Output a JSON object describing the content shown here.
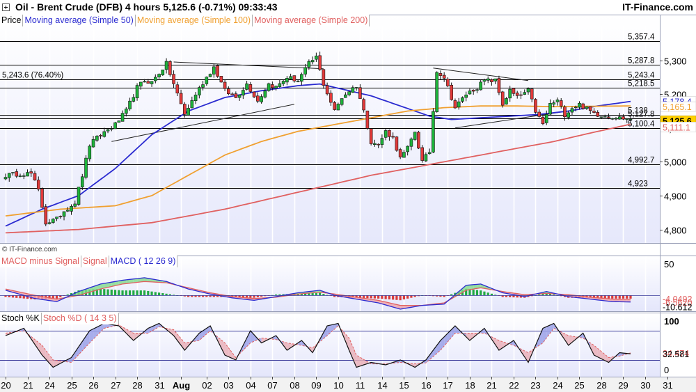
{
  "header": {
    "title": "Oil - Brent Crude (DFB)   4 hours   5,125.6 (-0.71%)   09:33:43",
    "brand": "IT-Finance.com"
  },
  "legends": {
    "price": [
      {
        "label": "Price",
        "color": "#000000"
      },
      {
        "label": "Moving average (Simple 50)",
        "color": "#2b2bd0"
      },
      {
        "label": "Moving average (Simple 100)",
        "color": "#f0a030"
      },
      {
        "label": "Moving average (Simple 200)",
        "color": "#e06060"
      }
    ],
    "macd": [
      {
        "label": "MACD minus Signal",
        "color": "#e06060"
      },
      {
        "label": "Signal",
        "color": "#e06060"
      },
      {
        "label": "MACD ( 12 26 9)",
        "color": "#2b2bd0"
      }
    ],
    "stoch": [
      {
        "label": "Stoch %K",
        "color": "#000000"
      },
      {
        "label": "Stoch %D ( 14 3 5)",
        "color": "#e06060"
      }
    ]
  },
  "watermark": "© IT-Finance.com",
  "chart_data": {
    "type": "candlestick",
    "price_axis": {
      "ylim": [
        4760,
        5400
      ],
      "ticks": [
        {
          "v": 4800,
          "label": "4,800"
        },
        {
          "v": 4900,
          "label": "4,900"
        },
        {
          "v": 5000,
          "label": "5,000"
        },
        {
          "v": 5100,
          "label": "5,100"
        },
        {
          "v": 5200,
          "label": "5,200"
        },
        {
          "v": 5300,
          "label": "5,300"
        }
      ]
    },
    "x_axis": {
      "labels": [
        "20",
        "21",
        "24",
        "25",
        "26",
        "27",
        "28",
        "31",
        "Aug",
        "02",
        "03",
        "04",
        "07",
        "08",
        "09",
        "10",
        "11",
        "14",
        "15",
        "16",
        "17",
        "18",
        "21",
        "22",
        "23",
        "24",
        "25",
        "28",
        "29",
        "30",
        "31"
      ],
      "label_index": [
        0,
        6,
        12,
        18,
        24,
        30,
        36,
        42,
        48,
        55,
        61,
        67,
        73,
        79,
        85,
        91,
        97,
        103,
        109,
        115,
        121,
        127,
        133,
        139,
        145,
        151,
        157,
        163,
        169,
        175,
        181
      ],
      "total_bars": 172
    },
    "horizontal_levels": [
      {
        "value": 5357.4,
        "label": "5,357.4",
        "side": "right"
      },
      {
        "value": 5287.8,
        "label": "5,287.8",
        "side": "right"
      },
      {
        "value": 5243.6,
        "label": "5,243.6 (76.40%)",
        "side": "left"
      },
      {
        "value": 5243.4,
        "label": "5,243.4",
        "side": "right"
      },
      {
        "value": 5218.5,
        "label": "5,218.5",
        "side": "right"
      },
      {
        "value": 5138,
        "label": "5,138",
        "side": "right"
      },
      {
        "value": 5127.8,
        "label": "5,127.8",
        "side": "right"
      },
      {
        "value": 5100.4,
        "label": "5,100.4",
        "side": "right"
      },
      {
        "value": 4992.7,
        "label": "4,992.7",
        "side": "right"
      },
      {
        "value": 4923,
        "label": "4,923",
        "side": "right"
      }
    ],
    "price_tags": [
      {
        "value": 5178.4,
        "label": "5,178.4",
        "color": "#2b2bd0",
        "bg": "#ffffff"
      },
      {
        "value": 5165.1,
        "label": "5,165.1",
        "color": "#f0a030",
        "bg": "#ffffff"
      },
      {
        "value": 5125.6,
        "label": "5,125.6",
        "color": "#000000",
        "bg": "#ffd000"
      },
      {
        "value": 5111.1,
        "label": "5,111.1",
        "color": "#e06060",
        "bg": "#ffffff"
      }
    ],
    "trendlines": [
      {
        "points": [
          [
            29,
            5060
          ],
          [
            79,
            5170
          ]
        ]
      },
      {
        "points": [
          [
            46,
            5295
          ],
          [
            87,
            5275
          ]
        ]
      },
      {
        "points": [
          [
            117,
            5277
          ],
          [
            143,
            5240
          ]
        ]
      },
      {
        "points": [
          [
            123,
            5100
          ],
          [
            160,
            5160
          ]
        ]
      }
    ],
    "close_keypoints": [
      [
        0,
        4960
      ],
      [
        4,
        4965
      ],
      [
        7,
        4965
      ],
      [
        9,
        4915
      ],
      [
        11,
        4820
      ],
      [
        14,
        4830
      ],
      [
        16,
        4855
      ],
      [
        19,
        4880
      ],
      [
        21,
        4960
      ],
      [
        23,
        5050
      ],
      [
        26,
        5080
      ],
      [
        30,
        5110
      ],
      [
        33,
        5150
      ],
      [
        36,
        5220
      ],
      [
        38,
        5240
      ],
      [
        40,
        5235
      ],
      [
        44,
        5290
      ],
      [
        47,
        5200
      ],
      [
        49,
        5140
      ],
      [
        52,
        5200
      ],
      [
        55,
        5250
      ],
      [
        57,
        5280
      ],
      [
        60,
        5210
      ],
      [
        63,
        5190
      ],
      [
        66,
        5230
      ],
      [
        69,
        5180
      ],
      [
        72,
        5230
      ],
      [
        74,
        5220
      ],
      [
        77,
        5250
      ],
      [
        80,
        5240
      ],
      [
        83,
        5290
      ],
      [
        85,
        5310
      ],
      [
        87,
        5230
      ],
      [
        90,
        5150
      ],
      [
        92,
        5190
      ],
      [
        94,
        5210
      ],
      [
        96,
        5225
      ],
      [
        98,
        5150
      ],
      [
        100,
        5060
      ],
      [
        102,
        5050
      ],
      [
        104,
        5090
      ],
      [
        106,
        5070
      ],
      [
        108,
        5010
      ],
      [
        110,
        5040
      ],
      [
        112,
        5090
      ],
      [
        114,
        5000
      ],
      [
        116,
        5030
      ],
      [
        118,
        5270
      ],
      [
        120,
        5250
      ],
      [
        123,
        5160
      ],
      [
        126,
        5200
      ],
      [
        129,
        5220
      ],
      [
        131,
        5240
      ],
      [
        134,
        5240
      ],
      [
        136,
        5170
      ],
      [
        138,
        5210
      ],
      [
        140,
        5190
      ],
      [
        143,
        5210
      ],
      [
        145,
        5150
      ],
      [
        147,
        5110
      ],
      [
        149,
        5170
      ],
      [
        151,
        5180
      ],
      [
        153,
        5140
      ],
      [
        155,
        5160
      ],
      [
        157,
        5170
      ],
      [
        160,
        5150
      ],
      [
        162,
        5140
      ],
      [
        165,
        5135
      ],
      [
        168,
        5130
      ],
      [
        171,
        5125.6
      ]
    ],
    "series": [
      {
        "name": "Moving average (Simple 50)",
        "color": "#2b2bd0",
        "points": [
          [
            0,
            4810
          ],
          [
            10,
            4860
          ],
          [
            20,
            4900
          ],
          [
            30,
            4980
          ],
          [
            40,
            5080
          ],
          [
            50,
            5150
          ],
          [
            60,
            5190
          ],
          [
            70,
            5210
          ],
          [
            80,
            5225
          ],
          [
            86,
            5230
          ],
          [
            92,
            5215
          ],
          [
            100,
            5195
          ],
          [
            108,
            5165
          ],
          [
            116,
            5135
          ],
          [
            122,
            5125
          ],
          [
            130,
            5130
          ],
          [
            138,
            5135
          ],
          [
            146,
            5140
          ],
          [
            154,
            5150
          ],
          [
            162,
            5165
          ],
          [
            171,
            5178.4
          ]
        ]
      },
      {
        "name": "Moving average (Simple 100)",
        "color": "#f0a030",
        "points": [
          [
            0,
            4840
          ],
          [
            15,
            4860
          ],
          [
            30,
            4870
          ],
          [
            40,
            4900
          ],
          [
            50,
            4960
          ],
          [
            60,
            5020
          ],
          [
            70,
            5060
          ],
          [
            80,
            5090
          ],
          [
            90,
            5110
          ],
          [
            100,
            5130
          ],
          [
            110,
            5150
          ],
          [
            120,
            5160
          ],
          [
            130,
            5165
          ],
          [
            140,
            5165
          ],
          [
            150,
            5163
          ],
          [
            160,
            5164
          ],
          [
            171,
            5165.1
          ]
        ]
      },
      {
        "name": "Moving average (Simple 200)",
        "color": "#e06060",
        "points": [
          [
            0,
            4790
          ],
          [
            20,
            4800
          ],
          [
            40,
            4820
          ],
          [
            60,
            4860
          ],
          [
            80,
            4910
          ],
          [
            100,
            4960
          ],
          [
            110,
            4980
          ],
          [
            120,
            5000
          ],
          [
            130,
            5020
          ],
          [
            140,
            5040
          ],
          [
            150,
            5060
          ],
          [
            160,
            5085
          ],
          [
            171,
            5111.1
          ]
        ]
      }
    ],
    "macd": {
      "ylim": [
        -22,
        60
      ],
      "ticks": [
        {
          "v": 50,
          "label": "50"
        }
      ],
      "tags": [
        {
          "value": -4.049,
          "label": "-4.0492",
          "color": "#e06060"
        },
        {
          "value": -6.562,
          "label": "-6.5620",
          "color": "#e06060"
        },
        {
          "value": -10.612,
          "label": "-10.612",
          "color": "#000000"
        }
      ],
      "macd_keypoints": [
        [
          0,
          8
        ],
        [
          8,
          -5
        ],
        [
          14,
          -10
        ],
        [
          20,
          6
        ],
        [
          26,
          18
        ],
        [
          32,
          24
        ],
        [
          38,
          28
        ],
        [
          44,
          22
        ],
        [
          50,
          10
        ],
        [
          56,
          2
        ],
        [
          62,
          -4
        ],
        [
          68,
          -8
        ],
        [
          74,
          -2
        ],
        [
          80,
          4
        ],
        [
          86,
          8
        ],
        [
          90,
          0
        ],
        [
          96,
          -6
        ],
        [
          102,
          -12
        ],
        [
          108,
          -22
        ],
        [
          114,
          -16
        ],
        [
          120,
          -14
        ],
        [
          126,
          16
        ],
        [
          130,
          18
        ],
        [
          136,
          4
        ],
        [
          142,
          -2
        ],
        [
          148,
          6
        ],
        [
          154,
          -2
        ],
        [
          160,
          -6
        ],
        [
          166,
          -10
        ],
        [
          171,
          -10.6
        ]
      ],
      "signal_keypoints": [
        [
          0,
          10
        ],
        [
          8,
          0
        ],
        [
          14,
          -6
        ],
        [
          20,
          0
        ],
        [
          26,
          10
        ],
        [
          32,
          18
        ],
        [
          38,
          22
        ],
        [
          44,
          20
        ],
        [
          50,
          12
        ],
        [
          56,
          4
        ],
        [
          62,
          -2
        ],
        [
          68,
          -5
        ],
        [
          74,
          -3
        ],
        [
          80,
          2
        ],
        [
          86,
          5
        ],
        [
          90,
          2
        ],
        [
          96,
          -3
        ],
        [
          102,
          -8
        ],
        [
          108,
          -16
        ],
        [
          114,
          -16
        ],
        [
          120,
          -12
        ],
        [
          126,
          8
        ],
        [
          130,
          12
        ],
        [
          136,
          6
        ],
        [
          142,
          1
        ],
        [
          148,
          3
        ],
        [
          154,
          1
        ],
        [
          160,
          -3
        ],
        [
          166,
          -6
        ],
        [
          171,
          -6.56
        ]
      ]
    },
    "stoch": {
      "ylim": [
        0,
        100
      ],
      "ticks": [
        {
          "v": 0,
          "label": "0"
        },
        {
          "v": 100,
          "label": "100"
        }
      ],
      "overbought": 80,
      "oversold": 20,
      "tags": [
        {
          "value": 34.474,
          "label": "34.474",
          "color": "#e06060"
        },
        {
          "value": 32.581,
          "label": "32.581",
          "color": "#000000"
        }
      ],
      "k_keypoints": [
        [
          0,
          70
        ],
        [
          5,
          85
        ],
        [
          10,
          30
        ],
        [
          13,
          5
        ],
        [
          18,
          25
        ],
        [
          23,
          80
        ],
        [
          27,
          95
        ],
        [
          31,
          90
        ],
        [
          35,
          60
        ],
        [
          39,
          85
        ],
        [
          42,
          95
        ],
        [
          46,
          70
        ],
        [
          49,
          40
        ],
        [
          53,
          75
        ],
        [
          56,
          90
        ],
        [
          60,
          30
        ],
        [
          63,
          20
        ],
        [
          67,
          80
        ],
        [
          70,
          55
        ],
        [
          74,
          70
        ],
        [
          77,
          40
        ],
        [
          81,
          60
        ],
        [
          84,
          35
        ],
        [
          88,
          90
        ],
        [
          91,
          95
        ],
        [
          94,
          40
        ],
        [
          96,
          5
        ],
        [
          100,
          15
        ],
        [
          104,
          10
        ],
        [
          108,
          20
        ],
        [
          112,
          5
        ],
        [
          115,
          20
        ],
        [
          119,
          60
        ],
        [
          123,
          90
        ],
        [
          127,
          60
        ],
        [
          131,
          85
        ],
        [
          135,
          40
        ],
        [
          139,
          60
        ],
        [
          143,
          15
        ],
        [
          147,
          85
        ],
        [
          150,
          95
        ],
        [
          154,
          50
        ],
        [
          158,
          75
        ],
        [
          161,
          30
        ],
        [
          165,
          15
        ],
        [
          168,
          35
        ],
        [
          171,
          32.6
        ]
      ],
      "d_keypoints": [
        [
          0,
          75
        ],
        [
          5,
          80
        ],
        [
          10,
          50
        ],
        [
          13,
          20
        ],
        [
          18,
          15
        ],
        [
          23,
          55
        ],
        [
          27,
          85
        ],
        [
          31,
          92
        ],
        [
          35,
          75
        ],
        [
          39,
          75
        ],
        [
          42,
          88
        ],
        [
          46,
          82
        ],
        [
          49,
          55
        ],
        [
          53,
          60
        ],
        [
          56,
          80
        ],
        [
          60,
          55
        ],
        [
          63,
          25
        ],
        [
          67,
          55
        ],
        [
          70,
          65
        ],
        [
          74,
          62
        ],
        [
          77,
          55
        ],
        [
          81,
          50
        ],
        [
          84,
          45
        ],
        [
          88,
          70
        ],
        [
          91,
          90
        ],
        [
          94,
          65
        ],
        [
          96,
          30
        ],
        [
          100,
          12
        ],
        [
          104,
          12
        ],
        [
          108,
          15
        ],
        [
          112,
          12
        ],
        [
          115,
          14
        ],
        [
          119,
          40
        ],
        [
          123,
          75
        ],
        [
          127,
          75
        ],
        [
          131,
          75
        ],
        [
          135,
          60
        ],
        [
          139,
          50
        ],
        [
          143,
          35
        ],
        [
          147,
          55
        ],
        [
          150,
          85
        ],
        [
          154,
          70
        ],
        [
          158,
          65
        ],
        [
          161,
          50
        ],
        [
          165,
          25
        ],
        [
          168,
          28
        ],
        [
          171,
          34.5
        ]
      ]
    }
  }
}
